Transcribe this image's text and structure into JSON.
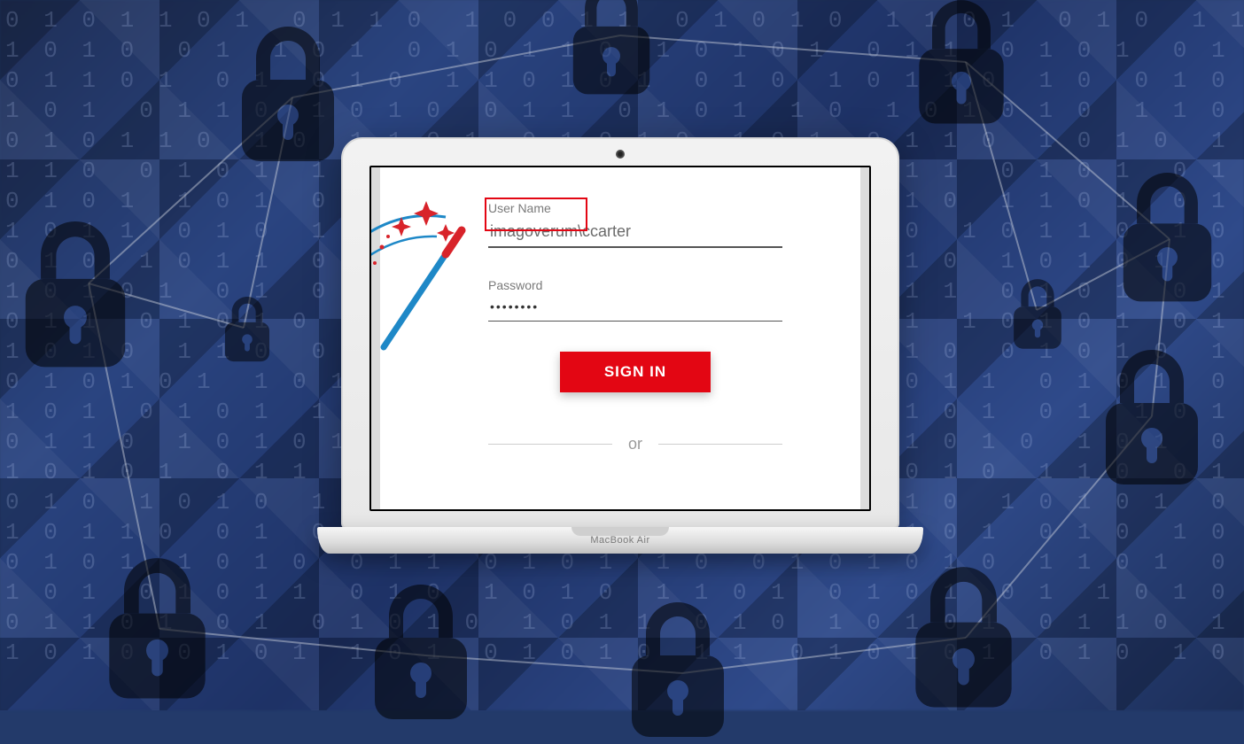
{
  "device": {
    "brand": "MacBook Air"
  },
  "form": {
    "username_label": "User Name",
    "username_value": "imagoverum\\ccarter",
    "password_label": "Password",
    "password_value": "••••••••",
    "signin_label": "SIGN IN",
    "or_label": "or"
  },
  "colors": {
    "accent_red": "#e30613",
    "bg_blue": "#2a4480"
  },
  "icons": {
    "lock": "lock-icon",
    "wand": "magic-wand-icon"
  },
  "bg_digits": "0 1 0 1 1 0 1  0 1 1 0  1 0 0 1 1  0 1 0 1 0  1 1 0 1  0 1 0  1 1 0 1 0 1\n1 0 1 0  0 1  1 0 1  0 1 0 1 1 0  1 0 1 0 1  0 1 1  0 1 0 1  0 1  1 0 1 0 1 0\n0 1 1 0 1  0 1  0 1 0  1 1 0 1 0 1  0 1 0  1 0 1 1 0  1 0  0 1 0 1  1 0 1 0 1\n1 0 1  0 1 1 0  1 0 1 0  0 1 1  0 1 0 1  1 0  1 0 1 0 1 0  1 1 0  0 1 0 1 0 1\n0 1 0 1 1 0  1 0  1 1 0 1  0 1 0 1 0  1 0 1  0 1 1 0  1 0 1 0  1 0 1  0 1 1 0\n1 1 0  0 1 0 1  1 0 1 0 1  0 1  1 0 1 0  0 1 0 1 1  0 1 0 1  0 1 0  1 0 1 1 0\n0 1 0 1  1 0 1  0 1 0  1 0 1 1 0 1  0 1  0 1 0 1 0  1 1 0 1  0 1  0 1 0 1 0 1\n1 0 1 1  0 1 0  1 0 1 0 1  0 1 1 0  1 0 1  0 1 0  1 0 1 1 0  1 0 1 0  0 1 0 1\n0 1 0  1 0 1 1  0 1 0 1  1 0  0 1 0 1 0 1  0 1 1 0  1 0 1 0 1  0 1 0  1 0 1 1\n1 0 1 0 1  0 1  0 1 1 0 1  0 1 0  1 0 1 0 1 0  1 1  0 1 0 1  0 1 0 1  1 0 1 0\n0 1 1  0 1 0 1 0  1 0 1  0 1 0 1 1  0 1 0 1  0 1  1 0 1 0 1  0 1 0  1 0 1 0 1\n1 0 1 0  1 1 0  0 1 0 1  1 0 1 0  0 1 0 1 0 1  1 0  0 1 0 1 0  1 0 1 1  0 1 0\n0 1 0 1 0 1  1 0 1  0 1 0  1 0 1 1 0  1 0 1 0  0 1 1  0 1 0 1  0 1 0  1 0 1 1\n1 0 1  0 1 0 1  1 0  0 1 0 1 0 1 0  1 1 0 1  0 1 0 1  0 1  1 0 1 0 1 0  0 1 0\n0 1 1 0  1 0 1 0 1  0 1 0  1 0 1  0 1 1 0 1  0 1 0 1 0  1 0 1  0 1 0  1 0 1 1\n1 0 1 0 1  0 1 1  0 1 0 1  0 1  1 0 1 0 1  0 1 0 1 0  1 1 0  0 1 0 1  1 0 1 0\n0 1 0  1 0 1 0  1 1 0 1  0 1 0 1 0  1 0 1  0 1 1 0  1 0 1 0 1  0 1 0  1 0 1 1\n1 0 1 1 0  0 1  0 1 0 1  1 0 1 0 1 0  0 1 0 1  1 0 1  0 1 0  1 0 1 0 1  0 1 0\n0 1 0 1  1 0 1 0  0 1 1  0 1 0 1  1 0  0 1 0 1 0 1 0  1 1 0 1  0 1 0 1  0 1 0\n1 0 1  0 1 0 1 1  0 1 0  1 0 1 0  1 1 0 1  0 1 0 1  0 1  1 0 1 0 1  0 1 0 1 0\n0 1 1 0 1  0 1  0 1 0 1 0  1 0 1 1  0 1 0  1 0 1 0 1  0 1 1 0  1 0 1  0 1 0 1\n1 0 1 0  0 1 0 1  1 0 1  0 1 0 1 0  1 1  0 1 0 1 0 1  0 1 0  1 0 1 1 0  0 1 0"
}
